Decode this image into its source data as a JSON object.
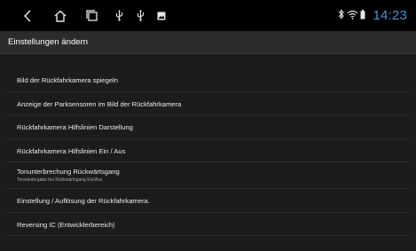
{
  "status_bar": {
    "buttons": [
      {
        "name": "back-icon"
      },
      {
        "name": "home-icon"
      },
      {
        "name": "recent-apps-icon"
      },
      {
        "name": "usb-icon"
      },
      {
        "name": "usb-icon"
      },
      {
        "name": "image-notification-icon"
      }
    ],
    "indicators": [
      "bluetooth-icon",
      "wifi-icon",
      "battery-icon"
    ],
    "time": "14:23",
    "time_color": "#3a9ad9"
  },
  "header": {
    "title": "Einstellungen ändern"
  },
  "settings": {
    "items": [
      {
        "label": "Bild der Rückfahrkamera spiegeln"
      },
      {
        "label": "Anzeige der Parksensoren im Bild der Rückfahrkamera"
      },
      {
        "label": "Rückfahrkamera Hilfslinien Darstellung"
      },
      {
        "label": "Rückfahrkamera Hilfslinien Ein / Aus"
      },
      {
        "label": "Tonunterbrechung Rückwärtsgang",
        "sublabel": "Tonwiedergabe bei Rückwärtsgang Ein/Aus"
      },
      {
        "label": "Einstellung / Auflösung der Rückfahrkamera."
      },
      {
        "label": "Reversing IC (Entwicklerbereich)"
      }
    ]
  }
}
